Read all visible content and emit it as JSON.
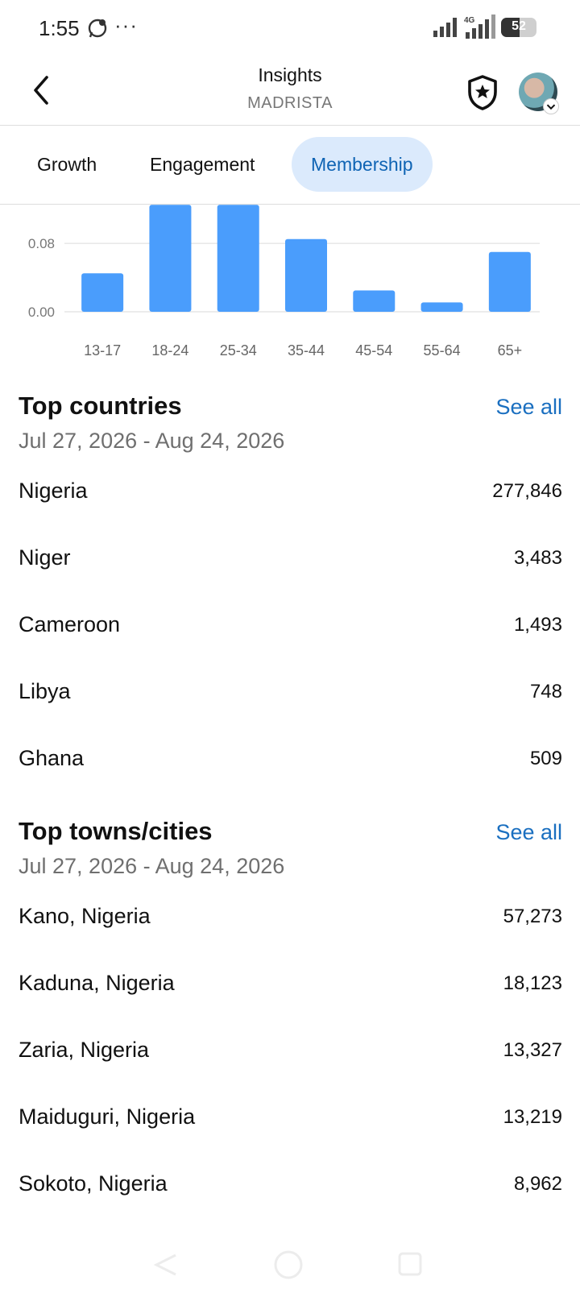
{
  "status_bar": {
    "time": "1:55",
    "more": "···",
    "battery": "52",
    "network": "4G",
    "icons": [
      "whatsapp-icon",
      "signal-icon",
      "lte-signal-icon",
      "battery-icon"
    ]
  },
  "header": {
    "title": "Insights",
    "subtitle": "MADRISTA",
    "icons": [
      "back-arrow-icon",
      "shield-star-icon",
      "avatar"
    ]
  },
  "tabs": [
    {
      "label": "Growth",
      "active": false
    },
    {
      "label": "Engagement",
      "active": false
    },
    {
      "label": "Membership",
      "active": true
    }
  ],
  "chart_data": {
    "type": "bar",
    "categories": [
      "13-17",
      "18-24",
      "25-34",
      "35-44",
      "45-54",
      "55-64",
      "65+"
    ],
    "values": [
      0.045,
      0.125,
      0.125,
      0.085,
      0.025,
      0.011,
      0.07
    ],
    "y_ticks": [
      "0.08",
      "0.00"
    ],
    "ylim": [
      0,
      0.13
    ],
    "bar_color": "#4a9dfc",
    "grid": true
  },
  "top_countries": {
    "title": "Top countries",
    "see_all": "See all",
    "date_range": "Jul 27, 2026 - Aug 24, 2026",
    "rows": [
      {
        "name": "Nigeria",
        "value": "277,846"
      },
      {
        "name": "Niger",
        "value": "3,483"
      },
      {
        "name": "Cameroon",
        "value": "1,493"
      },
      {
        "name": "Libya",
        "value": "748"
      },
      {
        "name": "Ghana",
        "value": "509"
      }
    ]
  },
  "top_cities": {
    "title": "Top towns/cities",
    "see_all": "See all",
    "date_range": "Jul 27, 2026 - Aug 24, 2026",
    "rows": [
      {
        "name": "Kano, Nigeria",
        "value": "57,273"
      },
      {
        "name": "Kaduna, Nigeria",
        "value": "18,123"
      },
      {
        "name": "Zaria, Nigeria",
        "value": "13,327"
      },
      {
        "name": "Maiduguri, Nigeria",
        "value": "13,219"
      },
      {
        "name": "Sokoto, Nigeria",
        "value": "8,962"
      }
    ]
  },
  "colors": {
    "accent": "#1a6fc0",
    "tab_active_bg": "#dbeafc",
    "bar": "#4a9dfc"
  }
}
